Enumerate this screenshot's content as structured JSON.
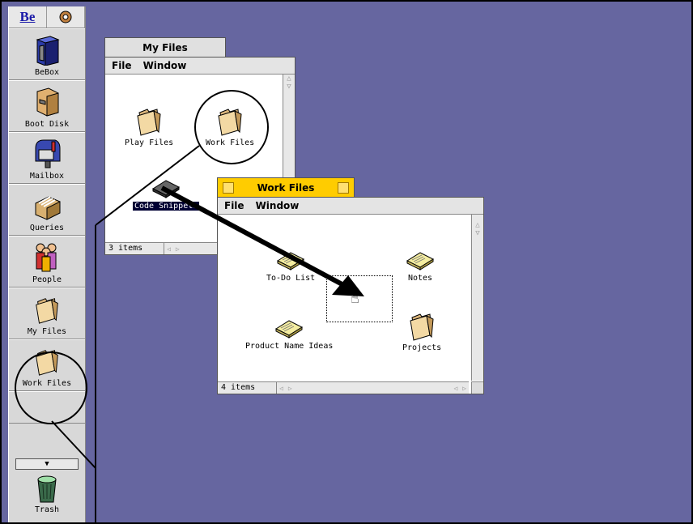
{
  "dock": {
    "logo": "Be",
    "items": [
      {
        "label": "BeBox",
        "icon": "bebox-icon"
      },
      {
        "label": "Boot Disk",
        "icon": "disk-icon"
      },
      {
        "label": "Mailbox",
        "icon": "mailbox-icon"
      },
      {
        "label": "Queries",
        "icon": "queries-icon"
      },
      {
        "label": "People",
        "icon": "people-icon"
      },
      {
        "label": "My Files",
        "icon": "folder-icon"
      },
      {
        "label": "Work Files",
        "icon": "folder-icon"
      }
    ],
    "trash_label": "Trash"
  },
  "my_files": {
    "title": "My Files",
    "menu": [
      "File",
      "Window"
    ],
    "icons": [
      {
        "label": "Play Files",
        "icon": "folder-icon"
      },
      {
        "label": "Work Files",
        "icon": "folder-icon"
      },
      {
        "label": "Code Snippets",
        "icon": "document-icon"
      }
    ],
    "status": "3 items"
  },
  "work_files": {
    "title": "Work Files",
    "menu": [
      "File",
      "Window"
    ],
    "icons": [
      {
        "label": "To-Do List",
        "icon": "document-icon"
      },
      {
        "label": "Notes",
        "icon": "document-icon"
      },
      {
        "label": "Product Name Ideas",
        "icon": "document-icon"
      },
      {
        "label": "Projects",
        "icon": "folder-icon"
      }
    ],
    "status": "4 items"
  },
  "colors": {
    "desktop": "#6666a0",
    "active_tab": "#ffcc00"
  }
}
